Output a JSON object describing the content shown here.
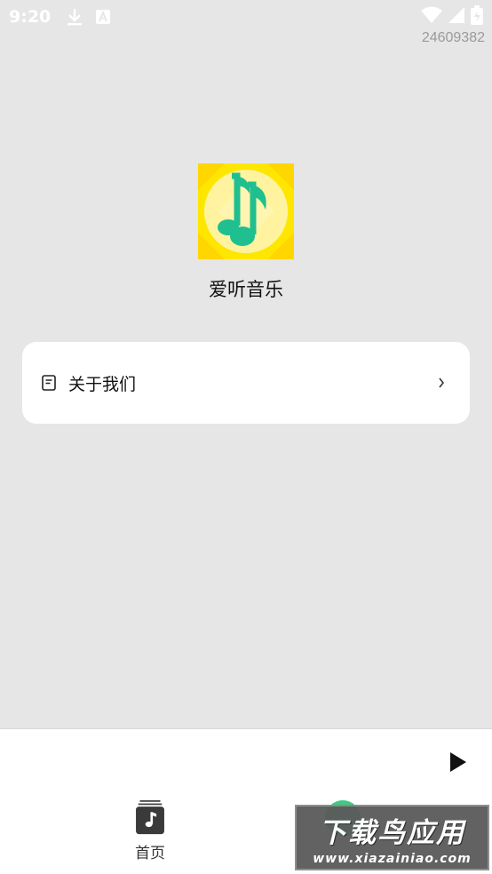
{
  "status_bar": {
    "time": "9:20",
    "left_icons": [
      "download-icon",
      "a-badge-icon"
    ],
    "right_icons": [
      "wifi-icon",
      "signal-icon",
      "battery-icon"
    ]
  },
  "build_number": "24609382",
  "app": {
    "name": "爱听音乐",
    "logo_icon": "music-note-icon",
    "logo_colors": {
      "background": "#ffe600",
      "circle": "#fff8b0",
      "note": "#1fbf8f"
    }
  },
  "menu": {
    "items": [
      {
        "label": "关于我们",
        "icon": "document-icon"
      }
    ]
  },
  "player": {
    "play_icon": "play-icon"
  },
  "bottom_nav": {
    "items": [
      {
        "label": "首页",
        "icon": "music-library-icon"
      },
      {
        "label": "",
        "icon": "profile-icon"
      }
    ]
  },
  "watermark": {
    "title": "下载鸟应用",
    "url": "www.xiazainiao.com"
  }
}
